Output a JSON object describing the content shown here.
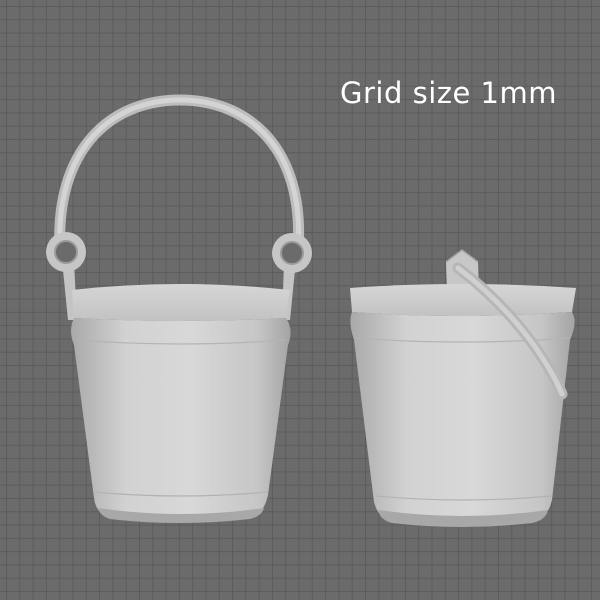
{
  "viewport": {
    "background_color": "#6b6b6b",
    "grid_line_color": "#5c5c5c",
    "label": "Grid size 1mm"
  },
  "models": [
    {
      "name": "bucket-front-view",
      "color": "#c9c9c9"
    },
    {
      "name": "bucket-side-view",
      "color": "#c9c9c9"
    }
  ]
}
